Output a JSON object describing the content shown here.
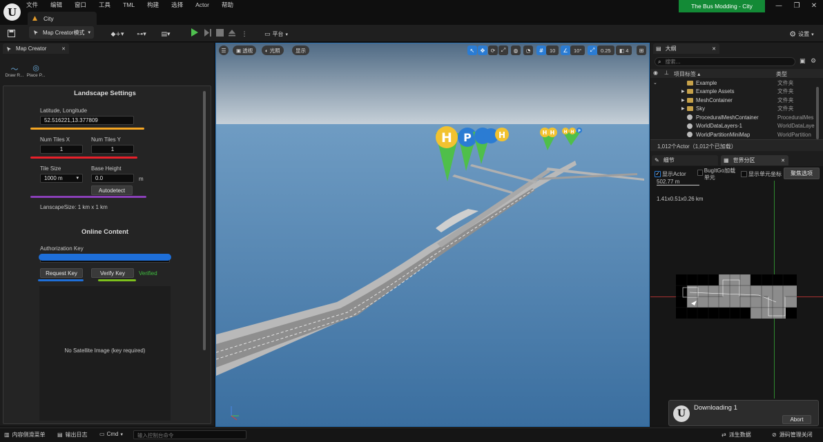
{
  "app": {
    "project_badge": "The Bus Modding - City",
    "logo_letter": "U"
  },
  "menu": [
    "文件",
    "编辑",
    "窗口",
    "工具",
    "TML",
    "构建",
    "选择",
    "Actor",
    "帮助"
  ],
  "tab": {
    "label": "City"
  },
  "window_controls": {
    "minimize": "—",
    "maximize": "❐",
    "close": "✕"
  },
  "toolbar": {
    "mode_label": "Map Creator模式",
    "platform_label": "平台",
    "settings_label": "设置"
  },
  "left_panel": {
    "tab_label": "Map Creator",
    "tools": [
      {
        "label": "Draw R...",
        "icon": "draw-road-icon"
      },
      {
        "label": "Place P...",
        "icon": "place-point-icon"
      }
    ],
    "landscape": {
      "heading": "Landscape Settings",
      "latlon_label": "Latitude, Longitude",
      "latlon_value": "52.516221,13.377809",
      "tiles_x_label": "Num Tiles X",
      "tiles_x_value": "1",
      "tiles_y_label": "Num Tiles Y",
      "tiles_y_value": "1",
      "tile_size_label": "Tile Size",
      "tile_size_value": "1000 m",
      "base_height_label": "Base Height",
      "base_height_value": "0.0",
      "base_height_unit": "m",
      "autodetect_label": "Autodetect",
      "size_text": "LanscapeSize: 1 km x 1 km"
    },
    "online": {
      "heading": "Online Content",
      "auth_label": "Authorization Key",
      "request_label": "Request Key",
      "verify_label": "Verify Key",
      "verified_text": "Verified",
      "satellite_text": "No Satellite Image (key required)"
    },
    "highlight_colors": {
      "orange": "#f5a623",
      "red": "#e8202a",
      "purple": "#8a3fb8",
      "blue": "#1e6fd9",
      "green": "#7dc11c"
    }
  },
  "viewport": {
    "perspective_label": "透视",
    "lit_label": "光照",
    "show_label": "显示",
    "grid_value": "10",
    "angle_value": "10°",
    "scale_value": "0.25",
    "camera_value": "4",
    "markers": [
      "H",
      "P",
      "H",
      "H",
      "H",
      "H",
      "H",
      "P"
    ]
  },
  "outliner": {
    "tab_label": "大纲",
    "search_placeholder": "搜索...",
    "col_label": "项目标签",
    "col_type": "类型",
    "rows": [
      {
        "name": "Example",
        "type": "文件夹",
        "kind": "folder"
      },
      {
        "name": "Example Assets",
        "type": "文件夹",
        "kind": "folder"
      },
      {
        "name": "MeshContainer",
        "type": "文件夹",
        "kind": "folder"
      },
      {
        "name": "Sky",
        "type": "文件夹",
        "kind": "folder"
      },
      {
        "name": "ProceduralMeshContainer",
        "type": "ProceduralMes",
        "kind": "actor"
      },
      {
        "name": "WorldDataLayers-1",
        "type": "WorldDataLaye",
        "kind": "actor"
      },
      {
        "name": "WorldPartitionMiniMap",
        "type": "WorldPartition",
        "kind": "actor"
      }
    ],
    "actor_count": "1,012个Actor（1,012个已加载）"
  },
  "details": {
    "tab_label": "细节",
    "world_partition_tab": "世界分区",
    "show_actor": "显示Actor",
    "bug_label": "BugItGo加载单元",
    "show_coords": "显示单元坐标",
    "focus_button": "聚焦选项",
    "scale_text": "502.77 m",
    "size_text": "1.41x0.51x0.26 km"
  },
  "toast": {
    "title": "Downloading 1",
    "abort_label": "Abort"
  },
  "statusbar": {
    "content_drawer": "内容侧滑菜单",
    "output_log": "输出日志",
    "cmd_label": "Cmd",
    "cmd_placeholder": "输入控制台命令",
    "derived_data": "派生数据",
    "source_control": "源码管理关闭"
  }
}
